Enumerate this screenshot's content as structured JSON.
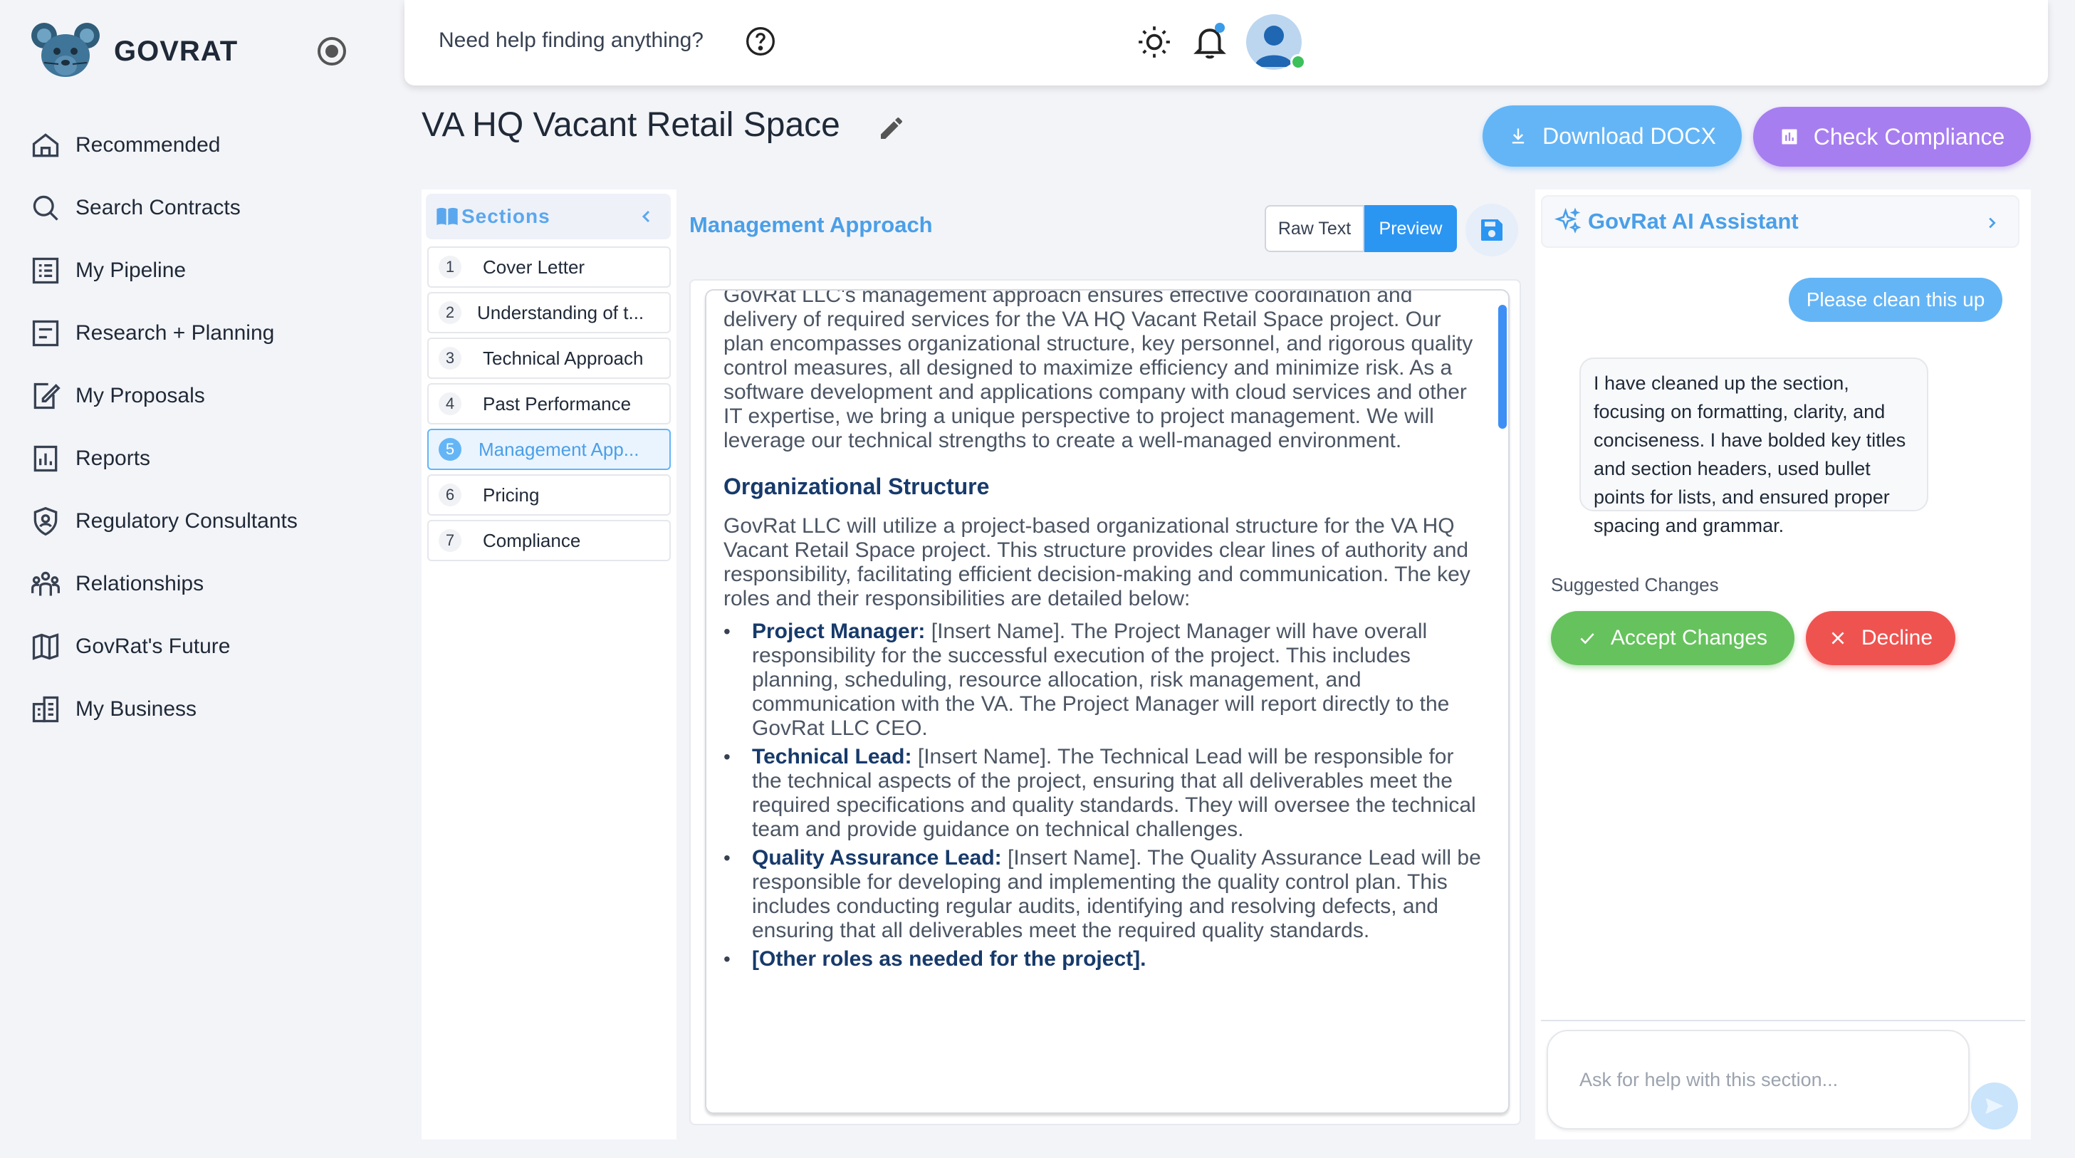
{
  "brand": {
    "name": "GOVRAT"
  },
  "nav": {
    "items": [
      {
        "label": "Recommended",
        "icon": "home-icon"
      },
      {
        "label": "Search Contracts",
        "icon": "search-icon"
      },
      {
        "label": "My Pipeline",
        "icon": "list-icon"
      },
      {
        "label": "Research + Planning",
        "icon": "research-icon"
      },
      {
        "label": "My Proposals",
        "icon": "edit-document-icon"
      },
      {
        "label": "Reports",
        "icon": "report-icon"
      },
      {
        "label": "Regulatory Consultants",
        "icon": "shield-user-icon"
      },
      {
        "label": "Relationships",
        "icon": "people-icon"
      },
      {
        "label": "GovRat's Future",
        "icon": "map-icon"
      },
      {
        "label": "My Business",
        "icon": "business-icon"
      }
    ]
  },
  "topbar": {
    "help_text": "Need help finding anything?"
  },
  "page": {
    "title": "VA HQ Vacant Retail Space",
    "download_label": "Download DOCX",
    "check_label": "Check Compliance"
  },
  "sections": {
    "title": "Sections",
    "items": [
      {
        "num": "1",
        "label": "Cover Letter"
      },
      {
        "num": "2",
        "label": "Understanding of t..."
      },
      {
        "num": "3",
        "label": "Technical Approach"
      },
      {
        "num": "4",
        "label": "Past Performance"
      },
      {
        "num": "5",
        "label": "Management App..."
      },
      {
        "num": "6",
        "label": "Pricing"
      },
      {
        "num": "7",
        "label": "Compliance"
      }
    ],
    "active_index": 4
  },
  "editor": {
    "title": "Management Approach",
    "raw_label": "Raw Text",
    "preview_label": "Preview",
    "intro": "GovRat LLC's management approach ensures effective coordination and delivery of required services for the VA HQ Vacant Retail Space project. Our plan encompasses organizational structure, key personnel, and rigorous quality control measures, all designed to maximize efficiency and minimize risk. As a software development and applications company with cloud services and other IT expertise, we bring a unique perspective to project management. We will leverage our technical strengths to create a well-managed environment.",
    "org_heading": "Organizational Structure",
    "org_paragraph": "GovRat LLC will utilize a project-based organizational structure for the VA HQ Vacant Retail Space project. This structure provides clear lines of authority and responsibility, facilitating efficient decision-making and communication. The key roles and their responsibilities are detailed below:",
    "roles": [
      {
        "title": "Project Manager:",
        "text": "[Insert Name]. The Project Manager will have overall responsibility for the successful execution of the project. This includes planning, scheduling, resource allocation, risk management, and communication with the VA. The Project Manager will report directly to the GovRat LLC CEO."
      },
      {
        "title": "Technical Lead:",
        "text": "[Insert Name]. The Technical Lead will be responsible for the technical aspects of the project, ensuring that all deliverables meet the required specifications and quality standards. They will oversee the technical team and provide guidance on technical challenges."
      },
      {
        "title": "Quality Assurance Lead:",
        "text": "[Insert Name]. The Quality Assurance Lead will be responsible for developing and implementing the quality control plan. This includes conducting regular audits, identifying and resolving defects, and ensuring that all deliverables meet the required quality standards."
      },
      {
        "title": "[Other roles as needed for the project].",
        "text": ""
      }
    ]
  },
  "assistant": {
    "title": "GovRat AI Assistant",
    "user_message": "Please clean this up",
    "bot_message": "I have cleaned up the section, focusing on formatting, clarity, and conciseness. I have bolded key titles and section headers, used bullet points for lists, and ensured proper spacing and grammar.",
    "suggested_label": "Suggested Changes",
    "accept_label": "Accept Changes",
    "decline_label": "Decline",
    "input_placeholder": "Ask for help with this section..."
  },
  "colors": {
    "accent": "#64b5f6",
    "check": "#a77ef0",
    "accept": "#66c25d",
    "decline": "#ef5350",
    "heading": "#173a6b"
  }
}
